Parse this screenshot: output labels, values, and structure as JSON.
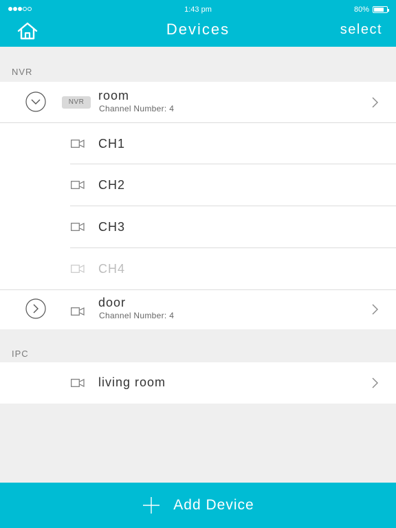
{
  "status_bar": {
    "time": "1:43 pm",
    "battery": "80%",
    "battery_level": 0.8
  },
  "nav": {
    "title": "Devices",
    "select_label": "select"
  },
  "sections": {
    "nvr": {
      "label": "NVR",
      "devices": [
        {
          "name": "room",
          "badge": "NVR",
          "channel_label": "Channel Number",
          "channel_value": "4",
          "expanded": true,
          "channels": [
            {
              "name": "CH1",
              "enabled": true
            },
            {
              "name": "CH2",
              "enabled": true
            },
            {
              "name": "CH3",
              "enabled": true
            },
            {
              "name": "CH4",
              "enabled": false
            }
          ]
        },
        {
          "name": "door",
          "channel_label": "Channel Number",
          "channel_value": "4",
          "expanded": false
        }
      ]
    },
    "ipc": {
      "label": "IPC",
      "devices": [
        {
          "name": "living room"
        }
      ]
    }
  },
  "footer": {
    "add_label": "Add Device"
  },
  "colors": {
    "accent": "#00bcd4",
    "background": "#efefef",
    "disabled_text": "#bdbdbd"
  },
  "icons": {
    "home": "home-icon",
    "expand_open": "chevron-down-circle-icon",
    "expand_closed": "chevron-right-circle-icon",
    "camera": "video-camera-icon",
    "disclosure": "chevron-right-icon",
    "add": "plus-icon"
  }
}
